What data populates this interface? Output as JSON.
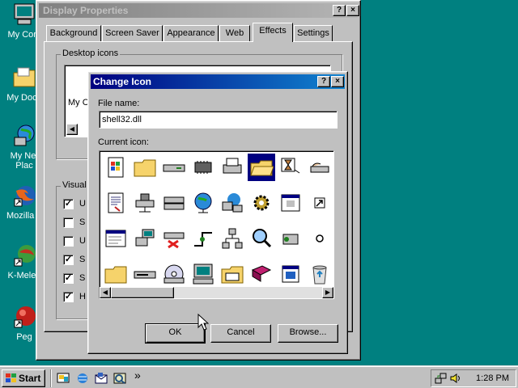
{
  "desktop": {
    "icons": [
      {
        "label": "My Com"
      },
      {
        "label": "My Docu"
      },
      {
        "label": "My Net"
      },
      {
        "label": "Plac"
      },
      {
        "label": "Mozilla F"
      },
      {
        "label": "K-Meleo"
      },
      {
        "label": "Peg"
      }
    ]
  },
  "display_properties": {
    "title": "Display Properties",
    "tabs": [
      "Background",
      "Screen Saver",
      "Appearance",
      "Web",
      "Effects",
      "Settings"
    ],
    "active_tab": "Effects",
    "desktop_icons_group": "Desktop icons",
    "partial_preview_label": "My C",
    "visual_group": "Visual",
    "checkbox_letters": [
      "U",
      "S",
      "U",
      "S",
      "S",
      "H"
    ],
    "checkbox_checked": [
      true,
      false,
      false,
      true,
      true,
      true
    ]
  },
  "change_icon": {
    "title": "Change Icon",
    "help_button": "?",
    "close_button": "×",
    "file_name_label": "File name:",
    "file_name_value": "shell32.dll",
    "current_icon_label": "Current icon:",
    "ok_label": "OK",
    "cancel_label": "Cancel",
    "browse_label": "Browse...",
    "selected_icon_index": 5,
    "icon_names": [
      "windows-doc-icon",
      "folder-icon",
      "drive-icon",
      "chip-icon",
      "printer-icon",
      "folder-open-icon",
      "hourglass-icon",
      "hand-drive-icon",
      "document-icon",
      "network-drive-icon",
      "drive-stack-icon",
      "globe-icon",
      "network-globe-icon",
      "gear-people-icon",
      "window-icon",
      "shortcut-arrow-icon",
      "window-list-icon",
      "network-pc-icon",
      "disconnected-drive-icon",
      "connection-icon",
      "network-tree-icon",
      "find-icon",
      "network-box-icon",
      "small-dot-icon",
      "folder-plain-icon",
      "cd-drive-icon",
      "cd-disc-icon",
      "computer-icon",
      "folder-programs-icon",
      "book-icon",
      "window-app-icon",
      "recycle-bin-icon"
    ]
  },
  "taskbar": {
    "start_label": "Start",
    "quick_launch": [
      "desktop-icon",
      "browser-icon",
      "outlook-icon",
      "channels-icon"
    ],
    "more_label": "»",
    "clock": "1:28 PM"
  }
}
